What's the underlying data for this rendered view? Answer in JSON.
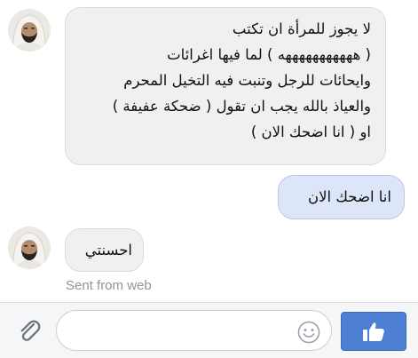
{
  "messages": [
    {
      "direction": "incoming",
      "text": "لا يجوز للمرأة ان تكتب\n( هههههههههههه ) لما فيها اغرائات\nوايحائات للرجل وتنبت فيه التخيل المحرم\nوالعياذ بالله يجب ان تقول ( ضحكة عفيفة )\nاو ( انا اضحك الان )"
    },
    {
      "direction": "outgoing",
      "text": "انا اضحك الان"
    },
    {
      "direction": "incoming",
      "text": "احسنتي",
      "meta": "Sent from web"
    }
  ],
  "composer": {
    "placeholder": "",
    "value": ""
  },
  "icons": {
    "attach": "paperclip-icon",
    "emoji": "smiley-icon",
    "like": "thumbs-up-icon"
  },
  "colors": {
    "incoming_bubble": "#f1f0f0",
    "outgoing_bubble": "#dce6f8",
    "like_button": "#4d7fd2"
  }
}
